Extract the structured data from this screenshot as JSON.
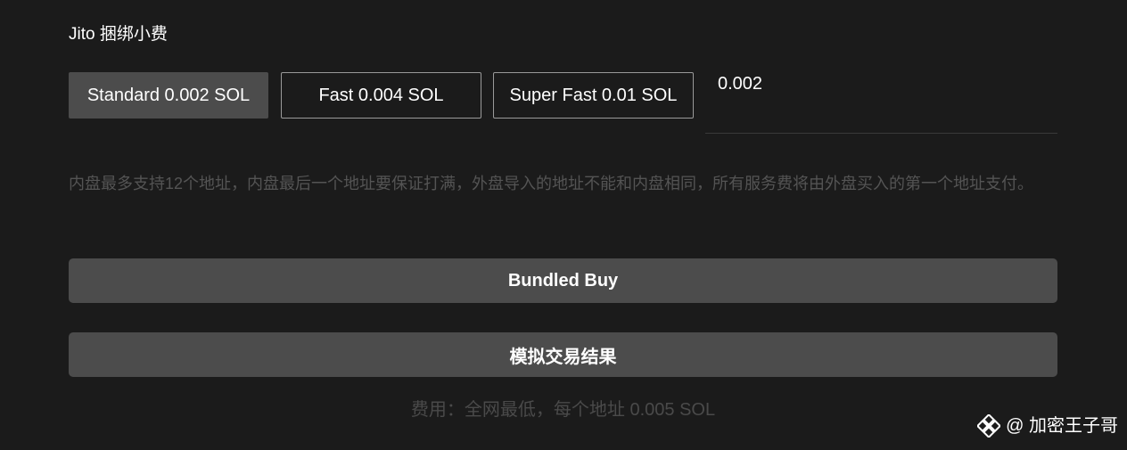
{
  "jito_section": {
    "title": "Jito 捆绑小费",
    "options": [
      {
        "label": "Standard 0.002 SOL",
        "selected": true
      },
      {
        "label": "Fast 0.004 SOL",
        "selected": false
      },
      {
        "label": "Super Fast 0.01 SOL",
        "selected": false
      }
    ],
    "custom_value": "0.002"
  },
  "notice": "内盘最多支持12个地址，内盘最后一个地址要保证打满，外盘导入的地址不能和内盘相同，所有服务费将由外盘买入的第一个地址支付。",
  "buttons": {
    "bundled_buy": "Bundled Buy",
    "simulate": "模拟交易结果"
  },
  "fee_text": "费用：全网最低，每个地址 0.005 SOL",
  "watermark": {
    "text": "@ 加密王子哥",
    "icon": "binance-logo-icon"
  },
  "colors": {
    "background": "#1b1b1b",
    "selected_option": "#4c4c4c",
    "button": "#4c4c4c",
    "muted_text": "#545454"
  }
}
